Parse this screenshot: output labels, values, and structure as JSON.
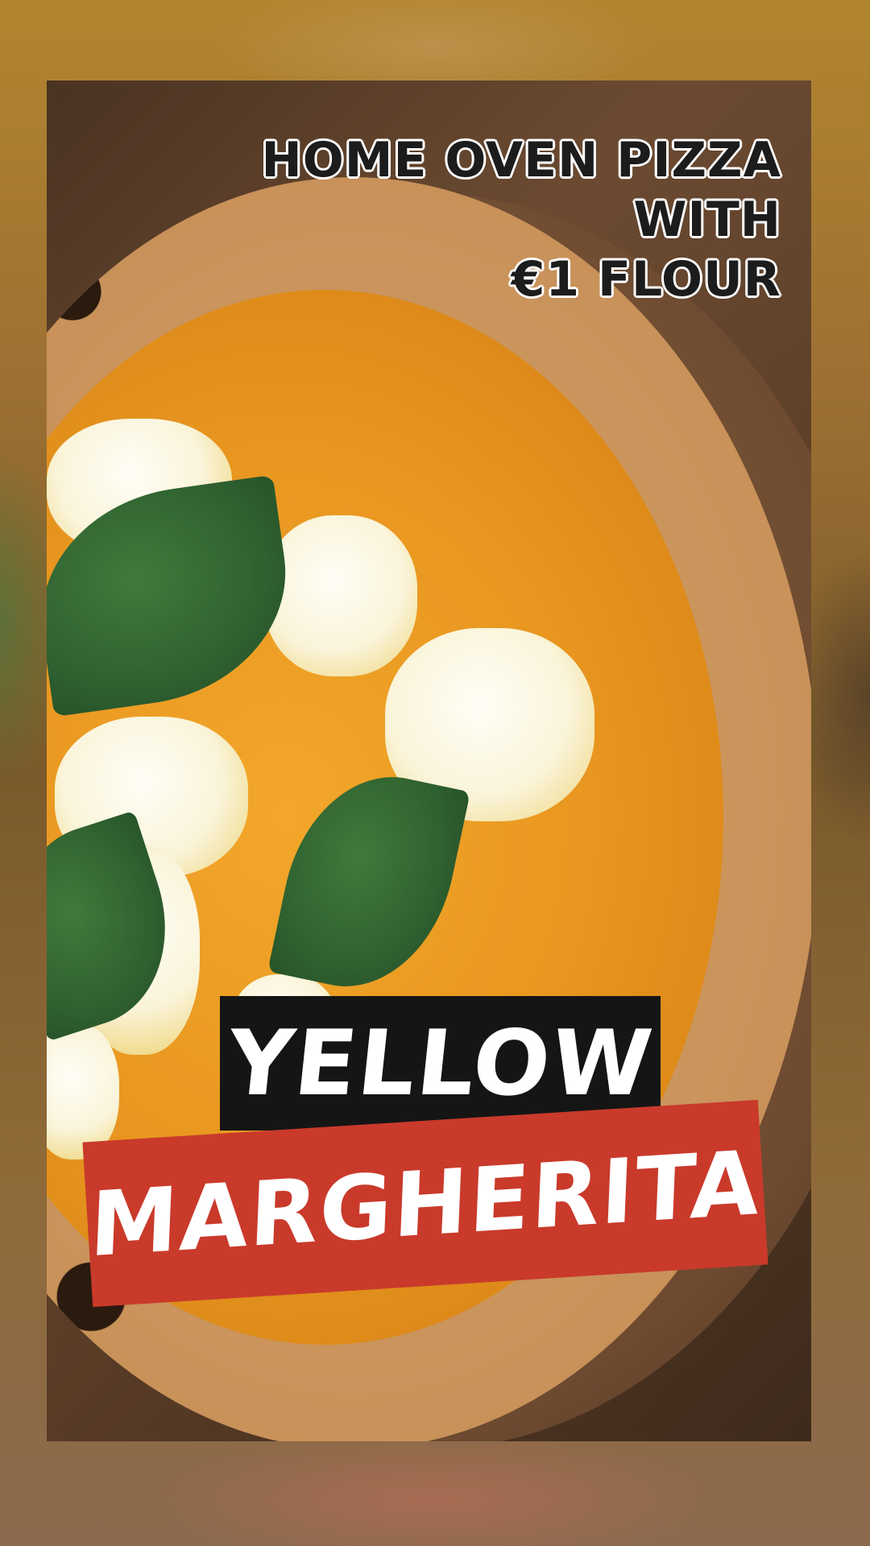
{
  "headline": {
    "line1": "HOME OVEN PIZZA",
    "line2": "WITH",
    "line3": "€1  FLOUR"
  },
  "labels": {
    "yellow": "YELLOW",
    "margherita": "MARGHERITA"
  },
  "colors": {
    "yellow_tag_bg": "#151515",
    "margherita_tag_bg": "#c93a2b",
    "label_text": "#ffffff"
  },
  "image_subject": "pizza-photo"
}
